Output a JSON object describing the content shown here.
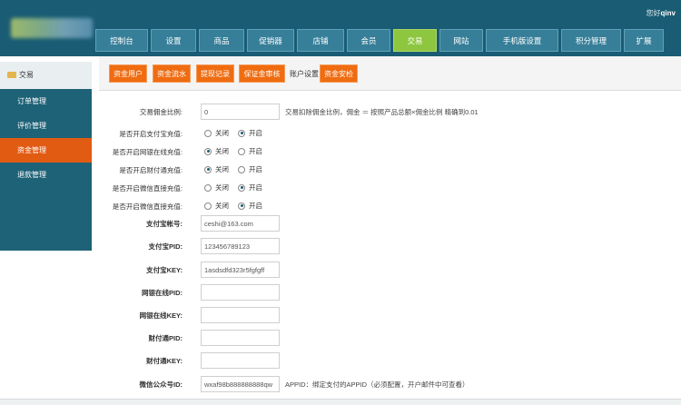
{
  "header": {
    "greeting_prefix": "您好",
    "greeting_user": "qinv"
  },
  "nav": {
    "items": [
      {
        "label": "控制台"
      },
      {
        "label": "设置"
      },
      {
        "label": "商品"
      },
      {
        "label": "促销器"
      },
      {
        "label": "店铺"
      },
      {
        "label": "会员"
      },
      {
        "label": "交易"
      },
      {
        "label": "网站"
      },
      {
        "label": "手机版设置"
      },
      {
        "label": "积分管理"
      },
      {
        "label": "扩展"
      }
    ],
    "active": "交易"
  },
  "sidebar": {
    "title": "交易",
    "items": [
      {
        "label": "订单管理"
      },
      {
        "label": "评价管理"
      },
      {
        "label": "资金管理"
      },
      {
        "label": "退款管理"
      }
    ],
    "active": "资金管理"
  },
  "subtabs": {
    "items": [
      {
        "label": "资金用户"
      },
      {
        "label": "资金流水"
      },
      {
        "label": "提现记录"
      },
      {
        "label": "保证金审核"
      },
      {
        "label": "账户设置"
      },
      {
        "label": "资金安检"
      }
    ],
    "active": "账户设置"
  },
  "form": {
    "commission": {
      "label": "交易佣金比例:",
      "value": "0",
      "hint": "交易扣除佣金比例，佣金 ＝ 按照产品总额×佣金比例 精确到0.01"
    },
    "toggles": [
      {
        "label": "是否开启支付宝充值:",
        "off": "关闭",
        "on": "开启",
        "value": "on"
      },
      {
        "label": "是否开启网银在线充值:",
        "off": "关闭",
        "on": "开启",
        "value": "off"
      },
      {
        "label": "是否开启财付通充值:",
        "off": "关闭",
        "on": "开启",
        "value": "off"
      },
      {
        "label": "是否开启微信直接充值:",
        "off": "关闭",
        "on": "开启",
        "value": "on"
      },
      {
        "label": "是否开启微信直接充值:",
        "off": "关闭",
        "on": "开启",
        "value": "on"
      }
    ],
    "fields": [
      {
        "label": "支付宝帐号:",
        "value": "ceshi@163.com"
      },
      {
        "label": "支付宝PID:",
        "value": "123456789123"
      },
      {
        "label": "支付宝KEY:",
        "value": "1asdsdfd323r5fgfgff"
      },
      {
        "label": "网银在线PID:",
        "value": ""
      },
      {
        "label": "网银在线KEY:",
        "value": ""
      },
      {
        "label": "财付通PID:",
        "value": ""
      },
      {
        "label": "财付通KEY:",
        "value": ""
      },
      {
        "label": "微信公众号ID:",
        "value": "wxaf98b888888888qw",
        "hint": "APPID：绑定支付的APPID（必须配置，开户邮件中可查看）"
      }
    ]
  }
}
